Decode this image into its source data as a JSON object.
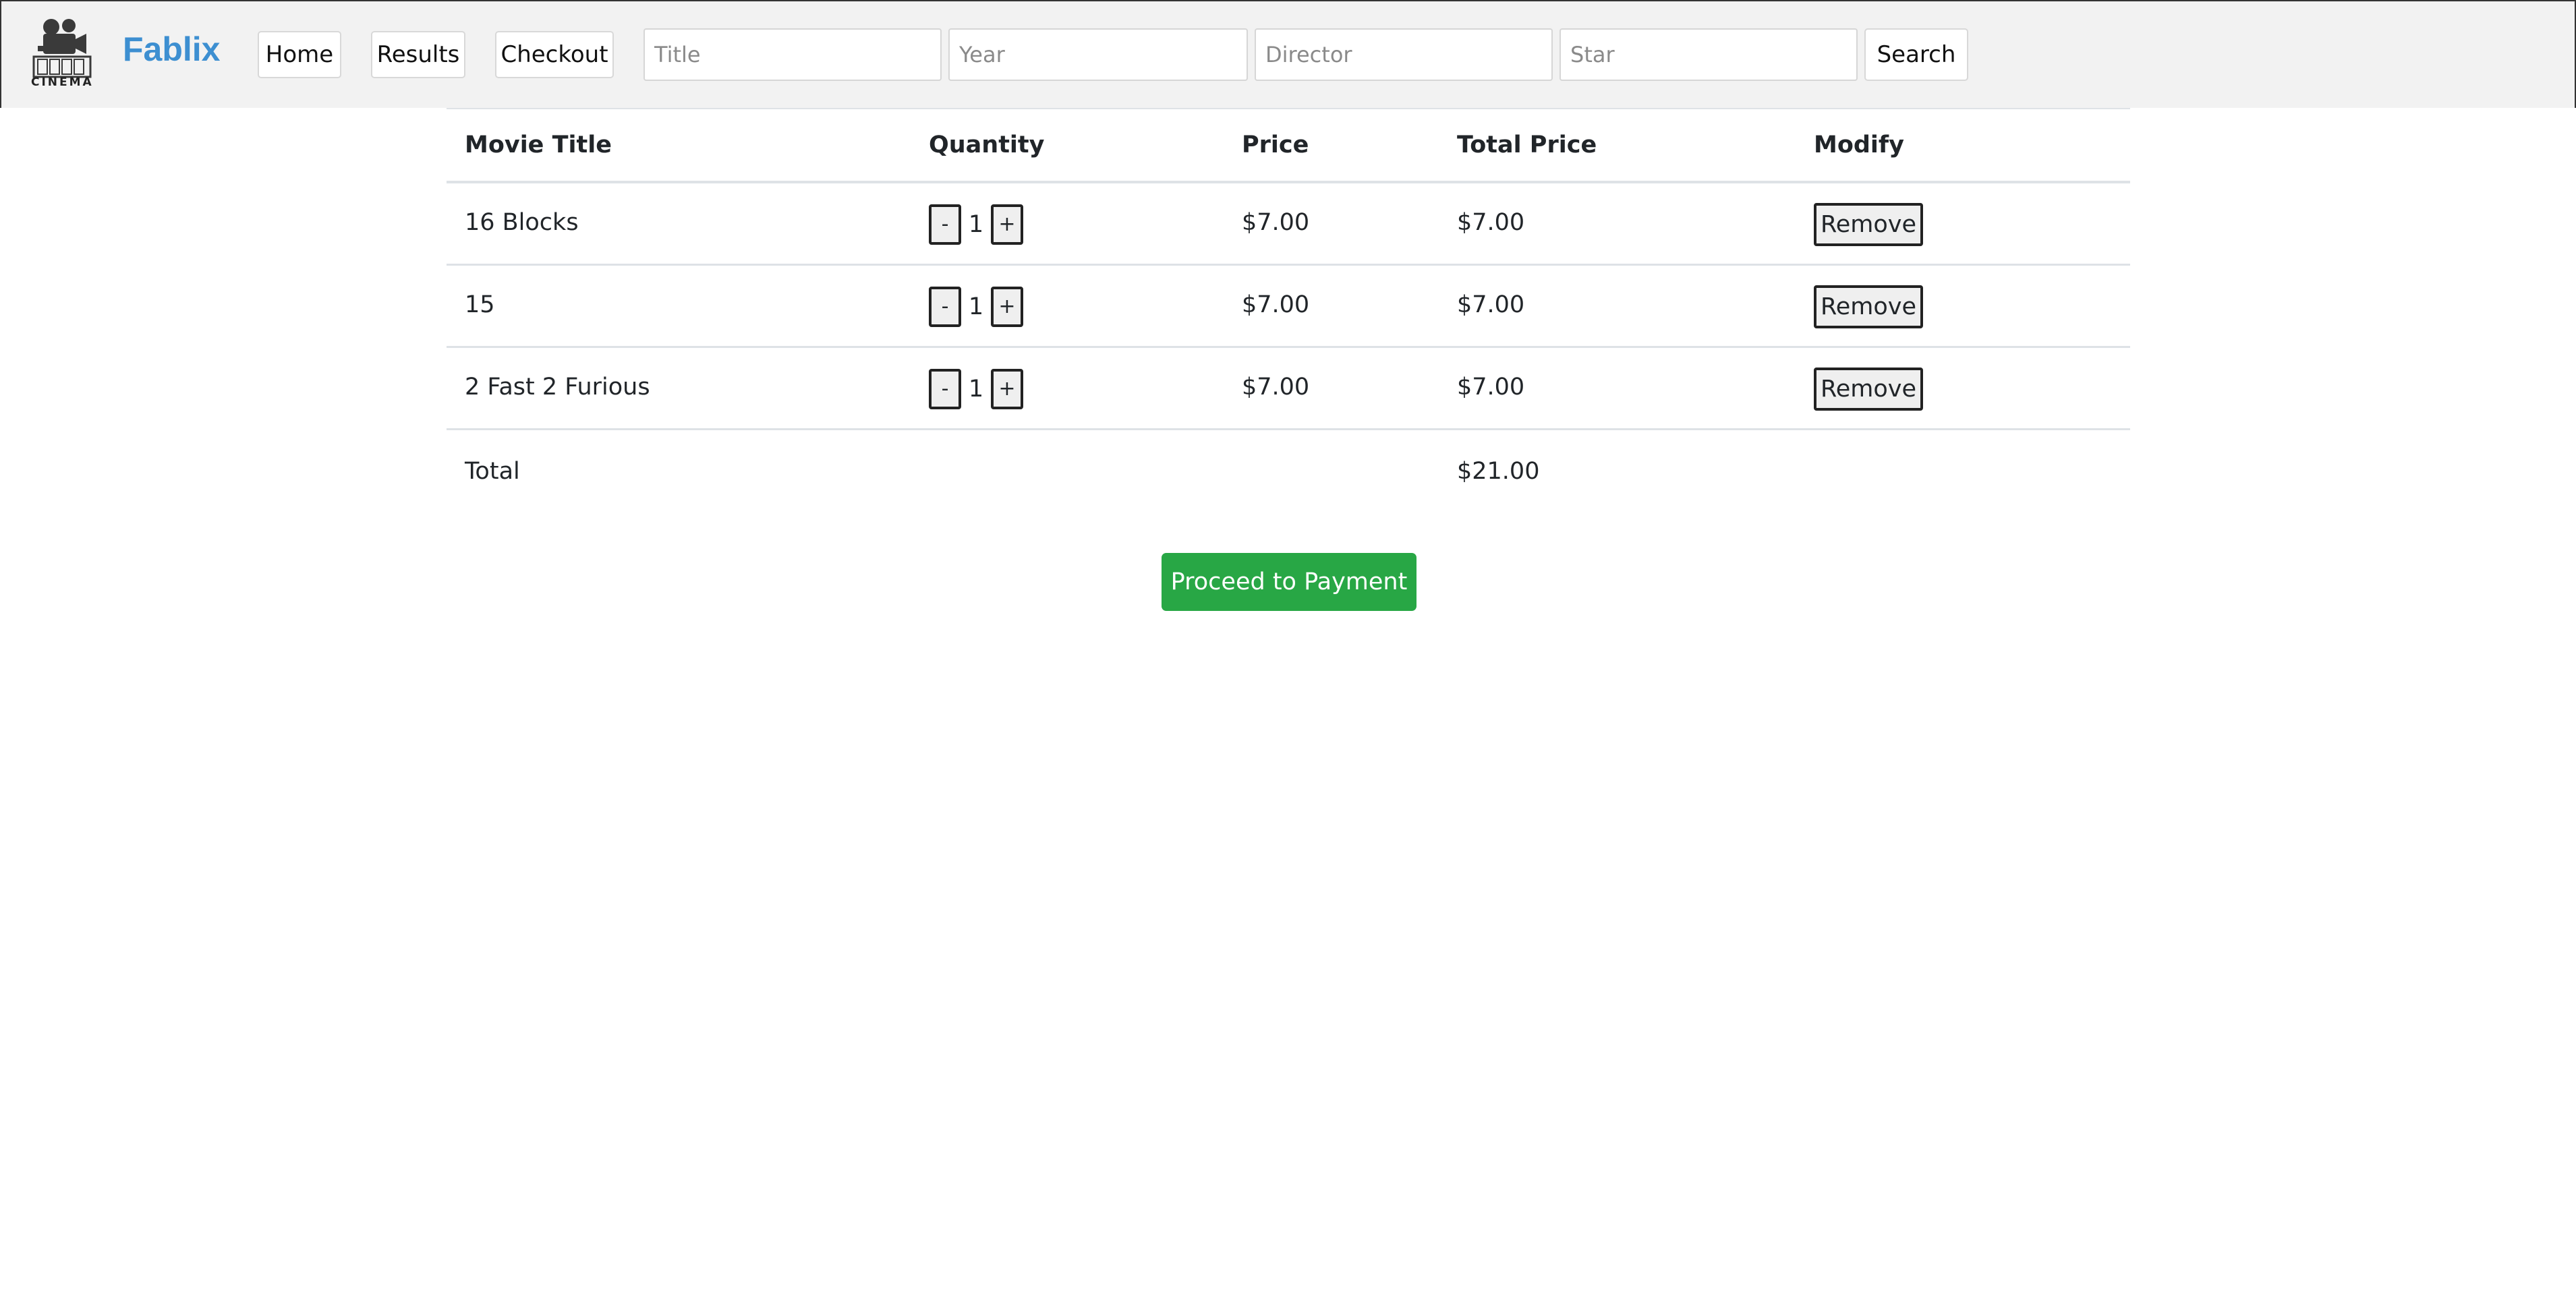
{
  "logo": {
    "icon": "movie-camera-icon",
    "caption": "CINEMA"
  },
  "brand": {
    "name": "Fablix",
    "color": "#3d8fd1"
  },
  "nav": {
    "home_label": "Home",
    "results_label": "Results",
    "checkout_label": "Checkout"
  },
  "search": {
    "title_placeholder": "Title",
    "year_placeholder": "Year",
    "director_placeholder": "Director",
    "star_placeholder": "Star",
    "button_label": "Search"
  },
  "cart": {
    "headers": {
      "title": "Movie Title",
      "quantity": "Quantity",
      "price": "Price",
      "total_price": "Total Price",
      "modify": "Modify"
    },
    "decrement_label": "-",
    "increment_label": "+",
    "remove_label": "Remove",
    "items": [
      {
        "title": "16 Blocks",
        "quantity": "1",
        "price": "$7.00",
        "total": "$7.00"
      },
      {
        "title": "15",
        "quantity": "1",
        "price": "$7.00",
        "total": "$7.00"
      },
      {
        "title": "2 Fast 2 Furious",
        "quantity": "1",
        "price": "$7.00",
        "total": "$7.00"
      }
    ],
    "total_label": "Total",
    "total_value": "$21.00"
  },
  "payment": {
    "button_label": "Proceed to Payment",
    "color": "#28a745"
  }
}
